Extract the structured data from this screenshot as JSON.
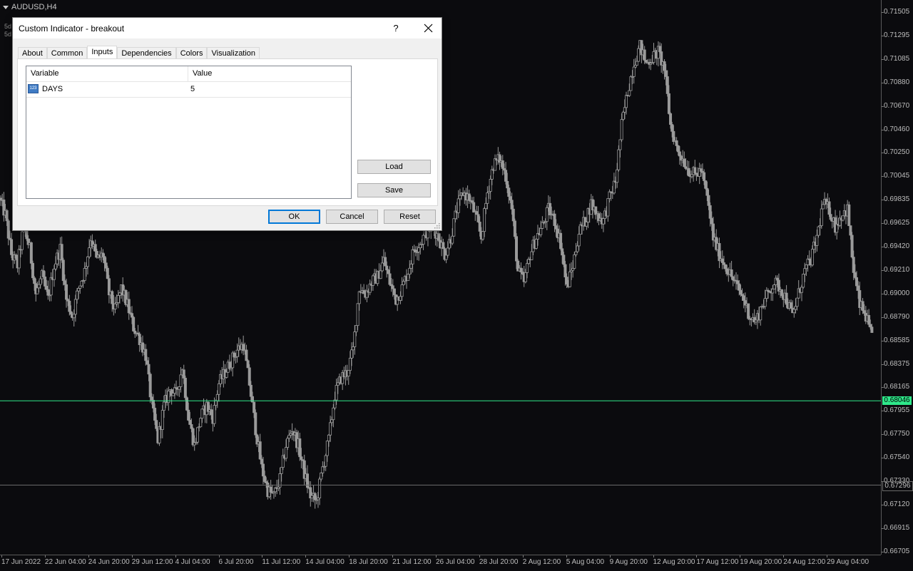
{
  "chart": {
    "symbol_label": "AUDUSD,H4",
    "sub_labels": [
      "5d",
      "5d"
    ],
    "current_price": "0.68046",
    "level_price": "0.67296",
    "price_ticks": [
      "0.71505",
      "0.71295",
      "0.71085",
      "0.70880",
      "0.70670",
      "0.70460",
      "0.70250",
      "0.70045",
      "0.69835",
      "0.69625",
      "0.69420",
      "0.69210",
      "0.69000",
      "0.68790",
      "0.68585",
      "0.68375",
      "0.68165",
      "0.67955",
      "0.67750",
      "0.67540",
      "0.67330",
      "0.67120",
      "0.66915",
      "0.66705"
    ],
    "time_ticks": [
      "17 Jun 2022",
      "22 Jun 04:00",
      "24 Jun 20:00",
      "29 Jun 12:00",
      "4 Jul 04:00",
      "6 Jul 20:00",
      "11 Jul 12:00",
      "14 Jul 04:00",
      "18 Jul 20:00",
      "21 Jul 12:00",
      "26 Jul 04:00",
      "28 Jul 20:00",
      "2 Aug 12:00",
      "5 Aug 04:00",
      "9 Aug 20:00",
      "12 Aug 20:00",
      "17 Aug 12:00",
      "19 Aug 20:00",
      "24 Aug 12:00",
      "29 Aug 04:00"
    ],
    "colors": {
      "background": "#0b0b0e",
      "candles": "#9a9a9a",
      "current_line": "#2ee88a",
      "level_line": "#6a6a6a"
    }
  },
  "chart_data": {
    "type": "candlestick",
    "title": "AUDUSD,H4",
    "ylim": [
      0.66705,
      0.71505
    ],
    "close_path": [
      0.6985,
      0.697,
      0.6935,
      0.6925,
      0.696,
      0.694,
      0.69,
      0.6915,
      0.6895,
      0.6925,
      0.694,
      0.6895,
      0.688,
      0.6905,
      0.692,
      0.695,
      0.693,
      0.6935,
      0.69,
      0.6885,
      0.6905,
      0.689,
      0.687,
      0.686,
      0.6845,
      0.68,
      0.677,
      0.68,
      0.6815,
      0.681,
      0.6835,
      0.679,
      0.6765,
      0.679,
      0.68,
      0.679,
      0.682,
      0.683,
      0.684,
      0.685,
      0.6855,
      0.682,
      0.678,
      0.6745,
      0.6725,
      0.672,
      0.6735,
      0.6765,
      0.678,
      0.6765,
      0.674,
      0.672,
      0.6715,
      0.6745,
      0.677,
      0.681,
      0.6825,
      0.683,
      0.685,
      0.6905,
      0.69,
      0.691,
      0.6915,
      0.693,
      0.691,
      0.6895,
      0.6905,
      0.692,
      0.694,
      0.6945,
      0.6955,
      0.696,
      0.695,
      0.6935,
      0.695,
      0.6975,
      0.699,
      0.6985,
      0.697,
      0.695,
      0.699,
      0.7015,
      0.702,
      0.7005,
      0.6975,
      0.692,
      0.691,
      0.6935,
      0.695,
      0.696,
      0.6975,
      0.6965,
      0.6945,
      0.6905,
      0.6925,
      0.6955,
      0.6965,
      0.698,
      0.697,
      0.6965,
      0.6985,
      0.7,
      0.705,
      0.708,
      0.7105,
      0.712,
      0.7105,
      0.711,
      0.7115,
      0.71,
      0.705,
      0.703,
      0.702,
      0.701,
      0.7005,
      0.701,
      0.6985,
      0.695,
      0.6935,
      0.6925,
      0.6915,
      0.6905,
      0.6895,
      0.688,
      0.6875,
      0.689,
      0.69,
      0.691,
      0.6905,
      0.6895,
      0.688,
      0.69,
      0.692,
      0.693,
      0.695,
      0.698,
      0.6975,
      0.696,
      0.697,
      0.6975,
      0.692,
      0.689,
      0.688,
      0.686
    ]
  },
  "dialog": {
    "title": "Custom Indicator - breakout",
    "help_label": "?",
    "tabs": [
      "About",
      "Common",
      "Inputs",
      "Dependencies",
      "Colors",
      "Visualization"
    ],
    "active_tab": "Inputs",
    "grid": {
      "col_variable": "Variable",
      "col_value": "Value",
      "rows": [
        {
          "type_icon": "123",
          "variable": "DAYS",
          "value": "5"
        }
      ]
    },
    "load_label": "Load",
    "save_label": "Save",
    "ok_label": "OK",
    "cancel_label": "Cancel",
    "reset_label": "Reset"
  }
}
